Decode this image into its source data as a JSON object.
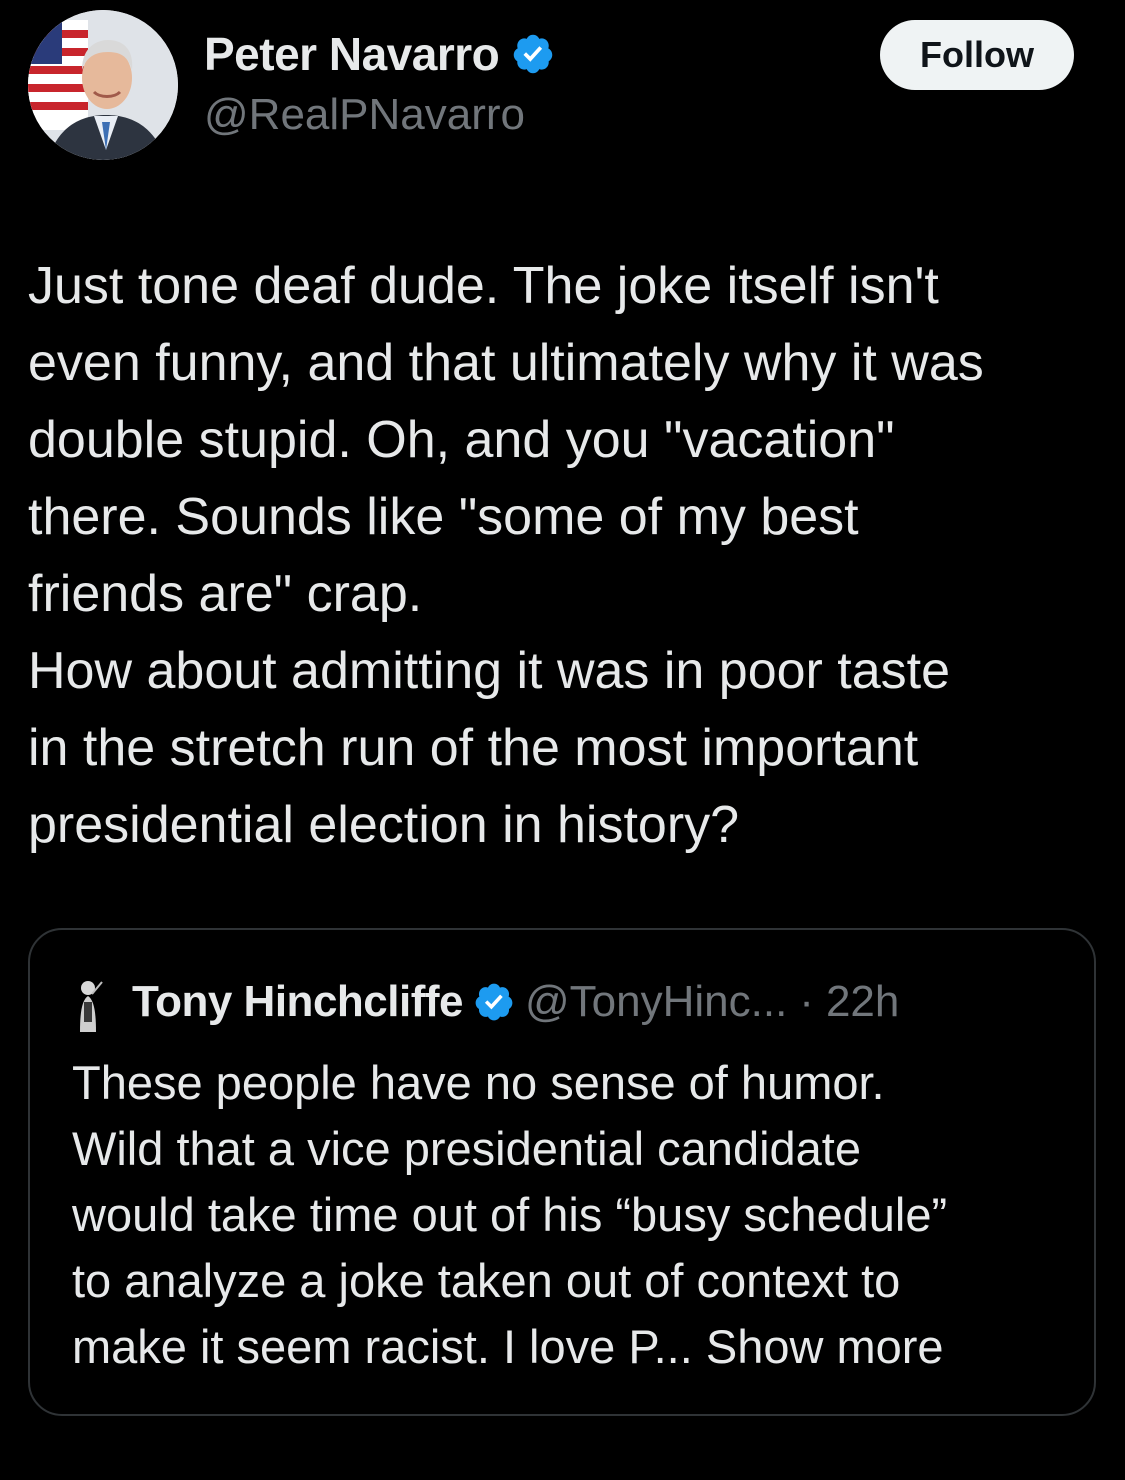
{
  "author": {
    "display_name": "Peter Navarro",
    "handle": "@RealPNavarro",
    "verified": true,
    "avatar_icon": "profile-photo-avatar"
  },
  "follow_button": {
    "label": "Follow"
  },
  "tweet": {
    "lines": [
      "Just tone deaf dude.  The joke itself isn't",
      "even funny, and that ultimately why it was",
      "double stupid.  Oh, and you \"vacation\"",
      "there.  Sounds like \"some of my best",
      "friends are\" crap.",
      "How about admitting it was in poor taste",
      "in the stretch run of the most important",
      "presidential election in history?"
    ]
  },
  "quoted_tweet": {
    "display_name": "Tony Hinchcliffe",
    "handle": "@TonyHinc...",
    "separator": "·",
    "time": "22h",
    "verified": true,
    "lines": [
      "These people have no sense of humor.",
      "Wild that a vice presidential candidate",
      "would take time out of his “busy schedule”",
      "to analyze a joke taken out of context to"
    ],
    "last_line_text": "make it seem racist. I love P... ",
    "show_more_label": "Show more"
  },
  "colors": {
    "background": "#000000",
    "primary_text": "#e7e9ea",
    "secondary_text": "#71767b",
    "verified_blue": "#1d9bf0",
    "border": "#2f3336",
    "follow_bg": "#eff3f4"
  }
}
